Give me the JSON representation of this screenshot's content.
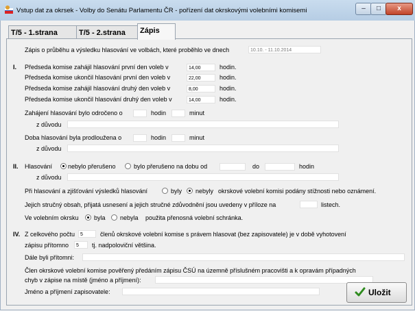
{
  "window": {
    "title": "Vstup dat za okrsek - Volby do Senátu Parlamentu ČR - pořízení dat okrskovými volebními komisemi",
    "minimize": "–",
    "maximize": "□",
    "close": "x"
  },
  "tabs": [
    "T/5 - 1.strana",
    "T/5 - 2.strana",
    "Zápis"
  ],
  "intro": {
    "label": "Zápis o průběhu a výsledku hlasování ve volbách, které proběhlo ve dnech",
    "dates": "10.10. - 11.10.2014"
  },
  "section1": {
    "num": "I.",
    "rows": [
      {
        "label": "Předseda komise zahájil hlasování první den voleb v",
        "value": "14,00",
        "unit": "hodin."
      },
      {
        "label": "Předseda komise ukončil hlasování první den voleb v",
        "value": "22,00",
        "unit": "hodin."
      },
      {
        "label": "Předseda komise zahájil hlasování druhý den voleb v",
        "value": "8,00",
        "unit": "hodin."
      },
      {
        "label": "Předseda komise ukončil hlasování druhý den voleb v",
        "value": "14,00",
        "unit": "hodin."
      }
    ],
    "postponed_label": "Zahájení hlasování bylo odročeno o",
    "hours": "hodin",
    "minutes": "minut",
    "reason_label": "z důvodu",
    "extended_label": "Doba hlasování byla prodloužena o"
  },
  "section2": {
    "num": "II.",
    "voting_label": "Hlasování",
    "opt_not_interrupted": "nebylo přerušeno",
    "opt_interrupted": "bylo přerušeno na dobu od",
    "to": "do",
    "hours": "hodin",
    "reason_label": "z důvodu",
    "complaints_pre": "Při hlasování a zjišťování výsledků hlasování",
    "opt_were": "byly",
    "opt_were_not": "nebyly",
    "complaints_post": "okrskové volební komisi podány stížnosti nebo oznámení.",
    "attachment_pre": "Jejich stručný obsah, přijatá usnesení a jejich stručné zdůvodnění jsou uvedeny v příloze na",
    "attachment_post": "listech.",
    "box_pre": "Ve volebním okrsku",
    "opt_was": "byla",
    "opt_was_not": "nebyla",
    "box_post": "použita přenosná volební schránka."
  },
  "section4": {
    "num": "IV.",
    "total_pre": "Z celkového počtu",
    "total_value": "5",
    "total_post": "členů okrskové volební komise s právem hlasovat (bez zapisovatele) je v době vyhotovení",
    "present_pre": "zápisu přítomno",
    "present_value": "5",
    "present_post": "tj. nadpoloviční většina.",
    "also_present": "Dále byli přítomni:",
    "delegated_line1": "Člen okrskové volební komise pověřený předáním zápisu ČSÚ na územně příslušném pracovišti a k opravám případných",
    "delegated_line2": "chyb v zápise na místě (jméno a příjmení):",
    "recorder": "Jméno a příjmení zapisovatele:"
  },
  "save_label": "Uložit"
}
